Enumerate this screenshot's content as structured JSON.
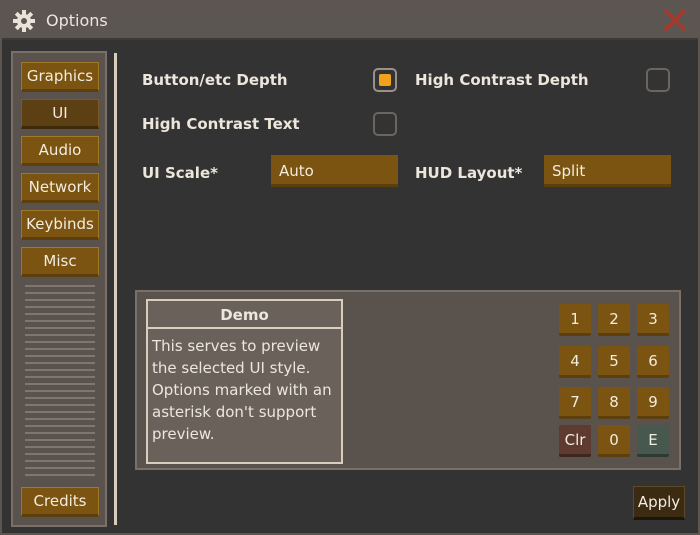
{
  "window": {
    "title": "Options",
    "icons": {
      "title": "gear-icon",
      "close": "close-icon"
    },
    "colors": {
      "accent": "#f0a21a",
      "button": "#7a5410",
      "close": "#a33a2e"
    }
  },
  "sidebar": {
    "tabs": [
      {
        "label": "Graphics",
        "active": false
      },
      {
        "label": "UI",
        "active": true
      },
      {
        "label": "Audio",
        "active": false
      },
      {
        "label": "Network",
        "active": false
      },
      {
        "label": "Keybinds",
        "active": false
      },
      {
        "label": "Misc",
        "active": false
      }
    ],
    "credits_label": "Credits"
  },
  "options": {
    "button_depth": {
      "label": "Button/etc Depth",
      "checked": true
    },
    "high_contrast_depth": {
      "label": "High Contrast Depth",
      "checked": false
    },
    "high_contrast_text": {
      "label": "High Contrast Text",
      "checked": false
    },
    "ui_scale": {
      "label": "UI Scale*",
      "value": "Auto"
    },
    "hud_layout": {
      "label": "HUD Layout*",
      "value": "Split"
    }
  },
  "demo": {
    "title": "Demo",
    "text": "This serves to preview the selected UI style. Options marked with an asterisk don't support preview.",
    "keypad": [
      "1",
      "2",
      "3",
      "4",
      "5",
      "6",
      "7",
      "8",
      "9",
      "Clr",
      "0",
      "E"
    ]
  },
  "footer": {
    "apply_label": "Apply"
  }
}
